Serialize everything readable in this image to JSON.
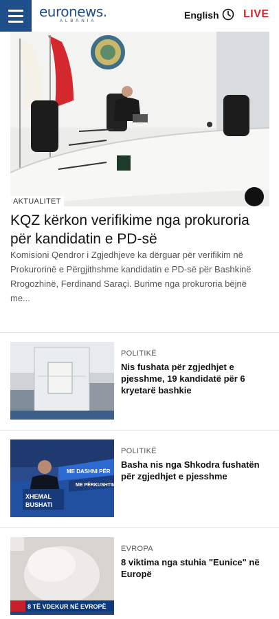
{
  "header": {
    "logo_main": "euronews.",
    "logo_sub": "ALBANIA",
    "language": "English",
    "live_label": "LIVE"
  },
  "hero": {
    "category": "AKTUALITET",
    "title": "KQZ kërkon verifikime nga prokuroria për kandidatin e PD-së",
    "summary": "Komisioni Qendror i Zgjedhjeve ka dërguar për verifikim në Prokurorinë e Përgjithshme kandidatin e PD-së për Bashkinë Rrogozhinë, Ferdinand Saraçi. Burime nga prokuroria bëjnë me..."
  },
  "articles": [
    {
      "category": "POLITIKË",
      "title": "Nis fushata për zgjedhjet e pjesshme, 19 kandidatë për 6 kryetarë bashkie"
    },
    {
      "category": "POLITIKË",
      "title": "Basha nis nga Shkodra fushatën për zgjedhjet e pjesshme",
      "image_text": {
        "banner": "ME DASHNI PËR",
        "banner2": "ME PËRKUSHTIM",
        "name1": "XHEMAL",
        "name2": "BUSHATI"
      }
    },
    {
      "category": "EVROPA",
      "title": "8 viktima nga stuhia \"Eunice\" në Europë",
      "image_text": {
        "ticker": "8 TË VDEKUR NË EVROPË"
      }
    }
  ],
  "icons": {
    "menu": "hamburger-icon",
    "clock": "clock-icon"
  },
  "colors": {
    "brand_blue": "#1f4f8a",
    "live_red": "#e0202a"
  }
}
